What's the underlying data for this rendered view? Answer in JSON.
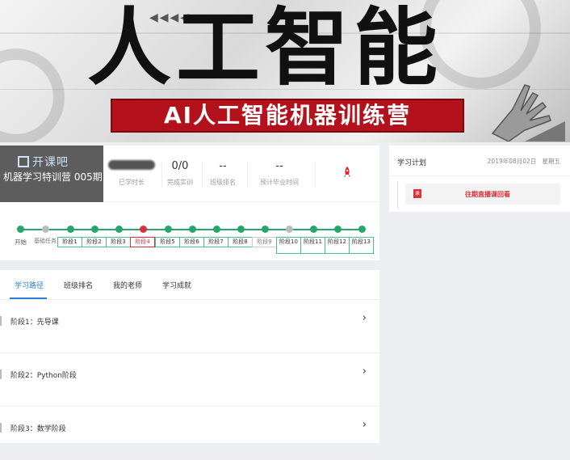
{
  "banner": {
    "title": "人工智能",
    "subtitle": "AI人工智能机器训练营",
    "arrows": "◀◀◀◀ ▸▸▸"
  },
  "course": {
    "logo_text": "开课吧",
    "name": "机器学习特训营 005期",
    "stats": [
      {
        "value": "",
        "label": "已学时长"
      },
      {
        "value": "0/0",
        "label": "完成实训"
      },
      {
        "value": "--",
        "label": "班级排名"
      },
      {
        "value": "--",
        "label": "预计毕业时间"
      }
    ],
    "rocket_icon": "rocket-icon"
  },
  "track": {
    "start_label": "开始",
    "base_label": "基础任务",
    "stages": [
      "阶段1",
      "阶段2",
      "阶段3",
      "阶段4",
      "阶段5",
      "阶段6",
      "阶段7",
      "阶段8",
      "阶段9",
      "阶段10",
      "阶段11",
      "阶段12",
      "阶段13"
    ],
    "current_stage": 4,
    "colors": {
      "done": "#26a66a",
      "current": "#d9303a",
      "pending": "#bbbbbb"
    }
  },
  "tabs": {
    "items": [
      "学习路径",
      "班级排名",
      "我的老师",
      "学习成就"
    ],
    "active": "学习路径"
  },
  "stages_list": [
    {
      "label": "阶段1：先导课"
    },
    {
      "label": "阶段2：Python阶段"
    },
    {
      "label": "阶段3：数学阶段"
    }
  ],
  "plan": {
    "title": "学习计划",
    "date": "2019年08月02日",
    "weekday": "星期五",
    "badge": "录",
    "link": "往期直播课回看"
  },
  "accent": "#2a7fd4",
  "brand_red": "#b3121c"
}
